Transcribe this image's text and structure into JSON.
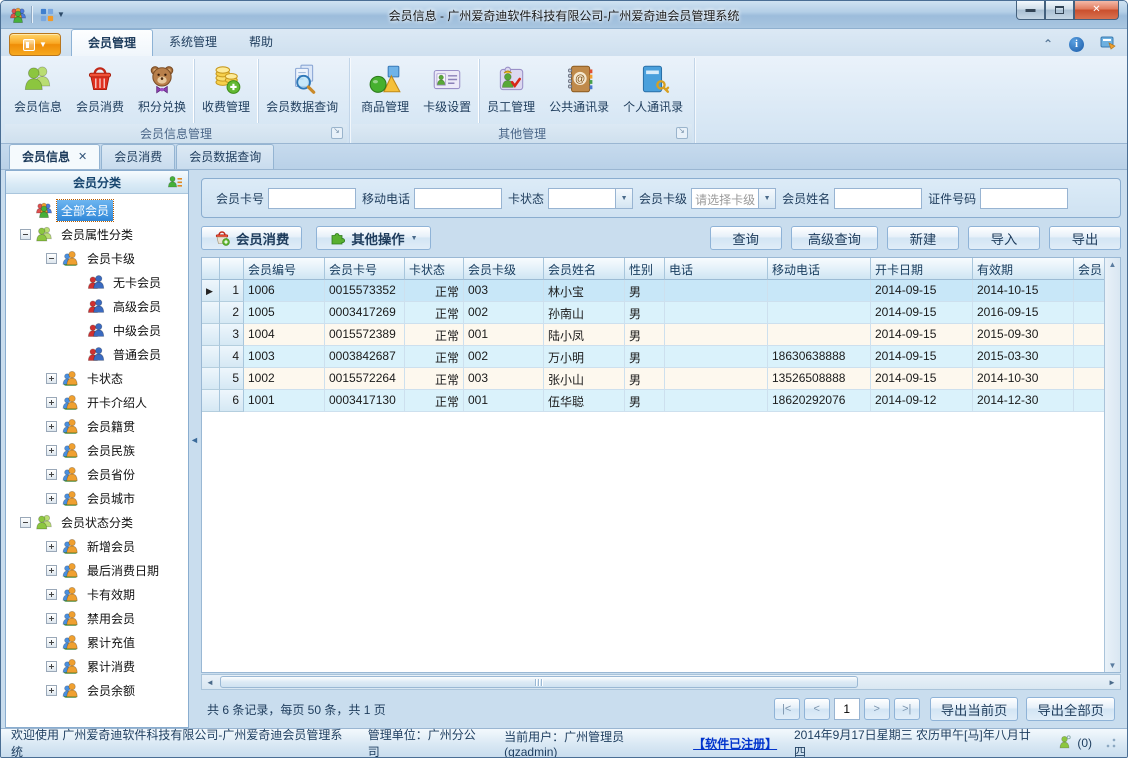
{
  "window": {
    "title": "会员信息 - 广州爱奇迪软件科技有限公司-广州爱奇迪会员管理系统",
    "controls": {
      "minimize": "最小化",
      "maximize": "最大化",
      "close": "关闭"
    }
  },
  "colors": {
    "accent_orange": "#f7a91f",
    "selection_blue": "#2f87d8",
    "link_blue": "#0033cc",
    "alt_row_blue": "#daf2fb",
    "alt_row_cream": "#fdf8ee"
  },
  "ribbon": {
    "tabs": [
      {
        "label": "会员管理",
        "active": true
      },
      {
        "label": "系统管理",
        "active": false
      },
      {
        "label": "帮助",
        "active": false
      }
    ],
    "groups": [
      {
        "label": "会员信息管理",
        "buttons": [
          {
            "label": "会员信息",
            "icon": "members-icon",
            "divider": false
          },
          {
            "label": "会员消费",
            "icon": "basket-icon",
            "divider": false
          },
          {
            "label": "积分兑换",
            "icon": "teddy-icon",
            "divider": false
          },
          {
            "label": "收费管理",
            "icon": "coins-icon",
            "divider": true
          },
          {
            "label": "会员数据查询",
            "icon": "search-doc-icon",
            "divider": true
          }
        ]
      },
      {
        "label": "其他管理",
        "buttons": [
          {
            "label": "商品管理",
            "icon": "shapes-icon",
            "divider": false
          },
          {
            "label": "卡级设置",
            "icon": "card-icon",
            "divider": false
          },
          {
            "label": "员工管理",
            "icon": "staff-icon",
            "divider": true
          },
          {
            "label": "公共通讯录",
            "icon": "address-book-icon",
            "divider": false
          },
          {
            "label": "个人通讯录",
            "icon": "personal-book-icon",
            "divider": false
          }
        ]
      }
    ]
  },
  "doc_tabs": [
    {
      "label": "会员信息",
      "active": true,
      "closable": true
    },
    {
      "label": "会员消费",
      "active": false,
      "closable": false
    },
    {
      "label": "会员数据查询",
      "active": false,
      "closable": false
    }
  ],
  "sidebar": {
    "title": "会员分类",
    "tree": [
      {
        "label": "全部会员",
        "level": 0,
        "exp": null,
        "icon": "tree-all-members-icon",
        "selected": true
      },
      {
        "label": "会员属性分类",
        "level": 0,
        "exp": "minus",
        "icon": "tree-green-group-icon",
        "selected": false
      },
      {
        "label": "会员卡级",
        "level": 1,
        "exp": "minus",
        "icon": "tree-category-icon",
        "selected": false
      },
      {
        "label": "无卡会员",
        "level": 2,
        "exp": null,
        "icon": "tree-member-icon",
        "selected": false
      },
      {
        "label": "高级会员",
        "level": 2,
        "exp": null,
        "icon": "tree-member-icon",
        "selected": false
      },
      {
        "label": "中级会员",
        "level": 2,
        "exp": null,
        "icon": "tree-member-icon",
        "selected": false
      },
      {
        "label": "普通会员",
        "level": 2,
        "exp": null,
        "icon": "tree-member-icon",
        "selected": false
      },
      {
        "label": "卡状态",
        "level": 1,
        "exp": "plus",
        "icon": "tree-category-icon",
        "selected": false
      },
      {
        "label": "开卡介绍人",
        "level": 1,
        "exp": "plus",
        "icon": "tree-category-icon",
        "selected": false
      },
      {
        "label": "会员籍贯",
        "level": 1,
        "exp": "plus",
        "icon": "tree-category-icon",
        "selected": false
      },
      {
        "label": "会员民族",
        "level": 1,
        "exp": "plus",
        "icon": "tree-category-icon",
        "selected": false
      },
      {
        "label": "会员省份",
        "level": 1,
        "exp": "plus",
        "icon": "tree-category-icon",
        "selected": false
      },
      {
        "label": "会员城市",
        "level": 1,
        "exp": "plus",
        "icon": "tree-category-icon",
        "selected": false
      },
      {
        "label": "会员状态分类",
        "level": 0,
        "exp": "minus",
        "icon": "tree-green-group-icon",
        "selected": false
      },
      {
        "label": "新增会员",
        "level": 1,
        "exp": "plus",
        "icon": "tree-category-icon",
        "selected": false
      },
      {
        "label": "最后消费日期",
        "level": 1,
        "exp": "plus",
        "icon": "tree-category-icon",
        "selected": false
      },
      {
        "label": "卡有效期",
        "level": 1,
        "exp": "plus",
        "icon": "tree-category-icon",
        "selected": false
      },
      {
        "label": "禁用会员",
        "level": 1,
        "exp": "plus",
        "icon": "tree-category-icon",
        "selected": false
      },
      {
        "label": "累计充值",
        "level": 1,
        "exp": "plus",
        "icon": "tree-category-icon",
        "selected": false
      },
      {
        "label": "累计消费",
        "level": 1,
        "exp": "plus",
        "icon": "tree-category-icon",
        "selected": false
      },
      {
        "label": "会员余额",
        "level": 1,
        "exp": "plus",
        "icon": "tree-category-icon",
        "selected": false
      }
    ]
  },
  "filters": [
    {
      "label": "会员卡号",
      "type": "input",
      "value": ""
    },
    {
      "label": "移动电话",
      "type": "input",
      "value": ""
    },
    {
      "label": "卡状态",
      "type": "select",
      "value": "",
      "muted": false
    },
    {
      "label": "会员卡级",
      "type": "select",
      "value": "请选择卡级",
      "muted": true
    },
    {
      "label": "会员姓名",
      "type": "input",
      "value": ""
    },
    {
      "label": "证件号码",
      "type": "input",
      "value": ""
    }
  ],
  "toolbar": {
    "left": [
      {
        "label": "会员消费",
        "icon": "basket-plus-icon",
        "dropdown": false
      },
      {
        "label": "其他操作",
        "icon": "puzzle-icon",
        "dropdown": true
      }
    ],
    "right": [
      "查询",
      "高级查询",
      "新建",
      "导入",
      "导出"
    ]
  },
  "table": {
    "columns": [
      "",
      "",
      "会员编号",
      "会员卡号",
      "卡状态",
      "会员卡级",
      "会员姓名",
      "性别",
      "电话",
      "移动电话",
      "开卡日期",
      "有效期",
      "会员"
    ],
    "rows": [
      {
        "num": "1",
        "selected": true,
        "cells": [
          "1006",
          "0015573352",
          "正常",
          "003",
          "林小宝",
          "男",
          "",
          "",
          "2014-09-15",
          "2014-10-15",
          ""
        ]
      },
      {
        "num": "2",
        "selected": false,
        "cells": [
          "1005",
          "0003417269",
          "正常",
          "002",
          "孙南山",
          "男",
          "",
          "",
          "2014-09-15",
          "2016-09-15",
          ""
        ]
      },
      {
        "num": "3",
        "selected": false,
        "cells": [
          "1004",
          "0015572389",
          "正常",
          "001",
          "陆小凤",
          "男",
          "",
          "",
          "2014-09-15",
          "2015-09-30",
          ""
        ]
      },
      {
        "num": "4",
        "selected": false,
        "cells": [
          "1003",
          "0003842687",
          "正常",
          "002",
          "万小明",
          "男",
          "",
          "18630638888",
          "2014-09-15",
          "2015-03-30",
          ""
        ]
      },
      {
        "num": "5",
        "selected": false,
        "cells": [
          "1002",
          "0015572264",
          "正常",
          "003",
          "张小山",
          "男",
          "",
          "13526508888",
          "2014-09-15",
          "2014-10-30",
          ""
        ]
      },
      {
        "num": "6",
        "selected": false,
        "cells": [
          "1001",
          "0003417130",
          "正常",
          "001",
          "伍华聪",
          "男",
          "",
          "18620292076",
          "2014-09-12",
          "2014-12-30",
          ""
        ]
      }
    ]
  },
  "pagination": {
    "summary": "共 6 条记录，每页 50 条，共 1 页",
    "first": "|<",
    "prev": "<",
    "page": "1",
    "next": ">",
    "last": ">|",
    "export_current": "导出当前页",
    "export_all": "导出全部页"
  },
  "statusbar": {
    "welcome": "欢迎使用 广州爱奇迪软件科技有限公司-广州爱奇迪会员管理系统",
    "org": "管理单位：广州分公司",
    "user": "当前用户：广州管理员(gzadmin)",
    "license": "【软件已注册】",
    "date": "2014年9月17日星期三 农历甲午[马]年八月廿四",
    "online_count": "(0)"
  }
}
